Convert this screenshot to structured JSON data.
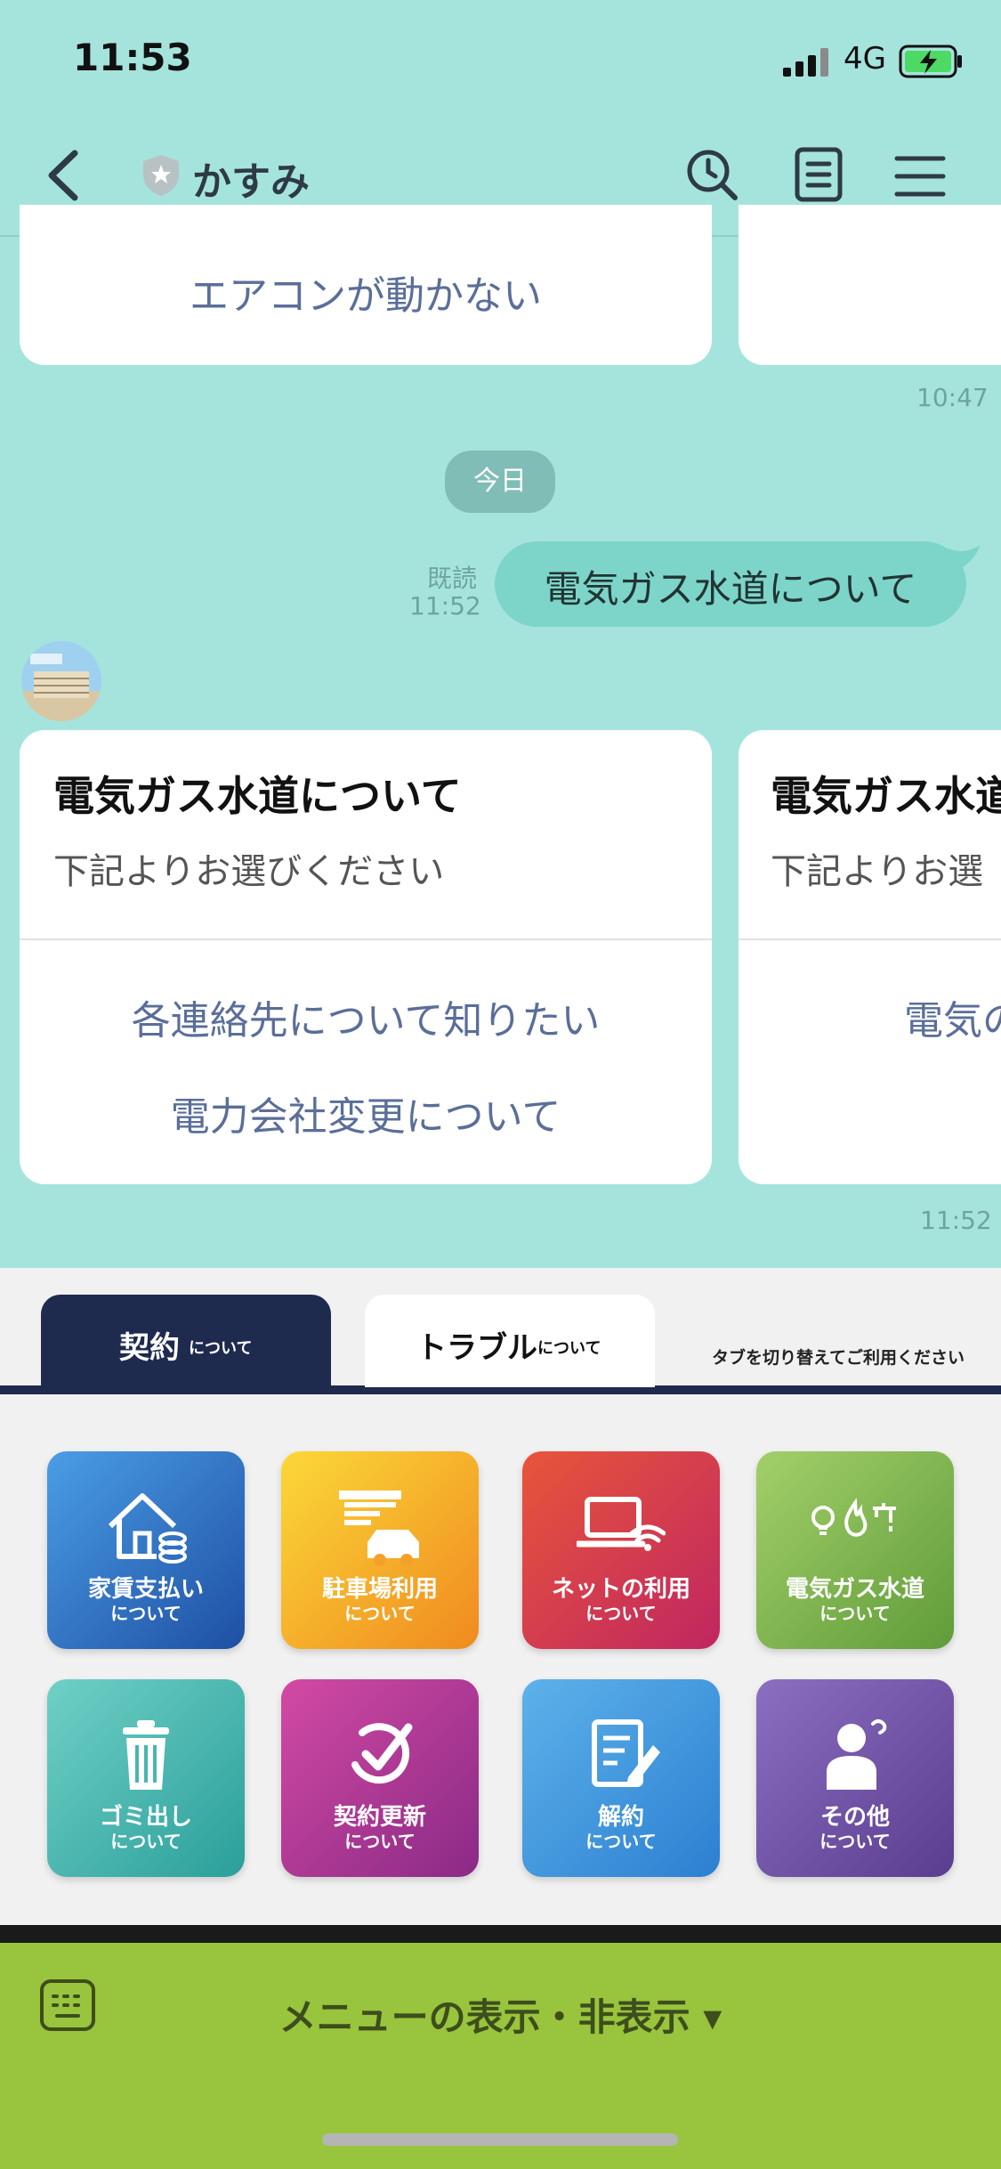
{
  "status_bar": {
    "time": "11:53",
    "network": "4G"
  },
  "nav": {
    "title": "かすみ"
  },
  "messages": {
    "top_card_label": "エアコンが動かない",
    "timestamp_1": "10:47",
    "date_chip": "今日",
    "read_label": "既読",
    "read_time": "11:52",
    "user_message": "電気ガス水道について",
    "timestamp_2": "11:52"
  },
  "carousel": [
    {
      "title": "電気ガス水道について",
      "subtitle": "下記よりお選びください",
      "links": [
        "各連絡先について知りたい",
        "電力会社変更について"
      ]
    },
    {
      "title": "電気ガス水道",
      "subtitle": "下記よりお選",
      "links": [
        "電気の"
      ]
    }
  ],
  "rich_menu": {
    "tabs": [
      {
        "label": "契約",
        "sub": "について"
      },
      {
        "label": "トラブル",
        "sub": "について"
      }
    ],
    "hint": "タブを切り替えてご利用ください",
    "tiles": [
      {
        "label": "家賃支払い",
        "sub": "について",
        "icon": "house-coins-icon",
        "color": "#2f6fc4"
      },
      {
        "label": "駐車場利用",
        "sub": "について",
        "icon": "parking-car-icon",
        "color": "#f2a62a"
      },
      {
        "label": "ネットの利用",
        "sub": "について",
        "icon": "laptop-wifi-icon",
        "color": "#d0344c"
      },
      {
        "label": "電気ガス水道",
        "sub": "について",
        "icon": "utilities-icon",
        "color": "#7fb34a"
      },
      {
        "label": "ゴミ出し",
        "sub": "について",
        "icon": "trash-icon",
        "color": "#49b8b1"
      },
      {
        "label": "契約更新",
        "sub": "について",
        "icon": "renew-check-icon",
        "color": "#a8318f"
      },
      {
        "label": "解約",
        "sub": "について",
        "icon": "document-edit-icon",
        "color": "#3f93dd"
      },
      {
        "label": "その他",
        "sub": "について",
        "icon": "person-question-icon",
        "color": "#6b4a9c"
      }
    ]
  },
  "bottom_bar": {
    "toggle_label": "メニューの表示・非表示 ▾"
  }
}
